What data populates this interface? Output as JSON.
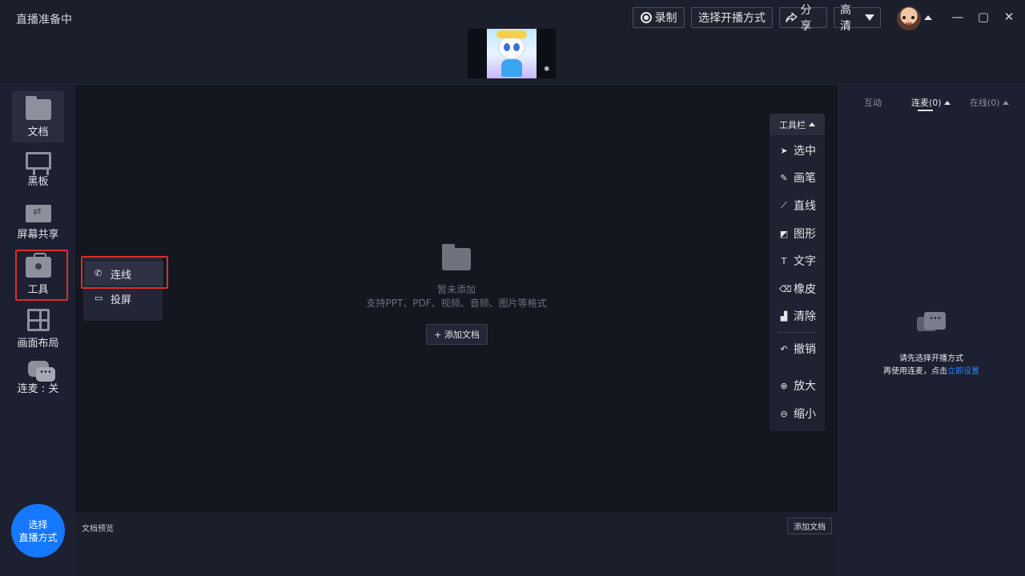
{
  "titlebar": {
    "title": "直播准备中",
    "record_label": "录制",
    "select_mode_label": "选择开播方式",
    "share_label": "分享",
    "quality_label": "高清",
    "share_icon": "share-arrow-icon"
  },
  "window_controls": {
    "minimize": "—",
    "restore": "▢",
    "close": "✕"
  },
  "sidebar": {
    "items": [
      {
        "label": "文档",
        "icon": "folder-icon"
      },
      {
        "label": "黑板",
        "icon": "blackboard-icon"
      },
      {
        "label": "屏幕共享",
        "icon": "screen-share-icon"
      },
      {
        "label": "工具",
        "icon": "toolbox-icon"
      },
      {
        "label": "画面布局",
        "icon": "layout-icon"
      },
      {
        "label": "连麦 : 关",
        "icon": "chat-icon"
      }
    ],
    "golive_line1": "选择",
    "golive_line2": "直播方式"
  },
  "tools_menu": {
    "items": [
      {
        "label": "连线",
        "icon": "phone-icon"
      },
      {
        "label": "投屏",
        "icon": "cast-icon"
      }
    ]
  },
  "main": {
    "empty_title": "暂未添加",
    "empty_sub": "支持PPT、PDF、视频、音频、图片等格式",
    "add_doc_label": "+ 添加文档"
  },
  "toolbar": {
    "header": "工具栏",
    "tools": [
      {
        "label": "选中",
        "icon": "cursor-icon",
        "glyph": "➤"
      },
      {
        "label": "画笔",
        "icon": "pen-icon",
        "glyph": "✎"
      },
      {
        "label": "直线",
        "icon": "line-icon",
        "glyph": "⟋"
      },
      {
        "label": "图形",
        "icon": "shape-icon",
        "glyph": "◩"
      },
      {
        "label": "文字",
        "icon": "text-icon",
        "glyph": "T"
      },
      {
        "label": "橡皮",
        "icon": "eraser-icon",
        "glyph": "⌫"
      },
      {
        "label": "清除",
        "icon": "clear-icon",
        "glyph": "▟"
      },
      {
        "label": "撤销",
        "icon": "undo-icon",
        "glyph": "↶"
      },
      {
        "label": "放大",
        "icon": "zoom-in-icon",
        "glyph": "⊕"
      },
      {
        "label": "缩小",
        "icon": "zoom-out-icon",
        "glyph": "⊖"
      }
    ]
  },
  "bottom": {
    "label": "文档预览",
    "add_doc_label": "添加文档"
  },
  "right_panel": {
    "tabs": [
      {
        "label": "互动"
      },
      {
        "label": "连麦(0)"
      },
      {
        "label": "在线(0)"
      }
    ],
    "line1": "请先选择开播方式",
    "line2_prefix": "再使用连麦，点击",
    "line2_link": "立即设置"
  },
  "colors": {
    "accent": "#1677ff",
    "highlight": "#e02b2b",
    "link": "#2f80ff"
  }
}
